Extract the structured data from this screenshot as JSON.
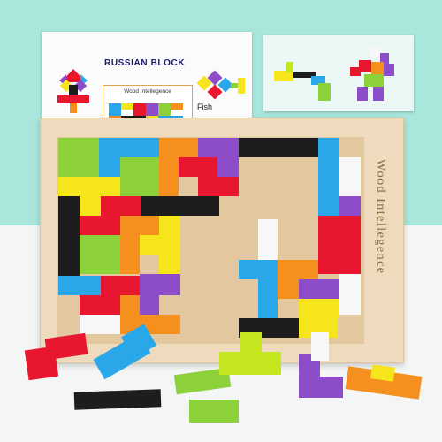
{
  "instruction_card": {
    "title": "RUSSIAN BLOCK",
    "preview_label": "Wood Intellegence",
    "example_label": "Fish"
  },
  "board": {
    "engraving": "Wood  Intellegence"
  },
  "colors": {
    "red": "#e8162e",
    "orange": "#f5901f",
    "yellow": "#f7e51b",
    "lime": "#c4e61e",
    "green": "#8cd13a",
    "blue": "#2aa7e8",
    "purple": "#8d4cc9",
    "black": "#1d1d1d",
    "white": "#f7f7f7",
    "wood": "#eedbbd"
  }
}
